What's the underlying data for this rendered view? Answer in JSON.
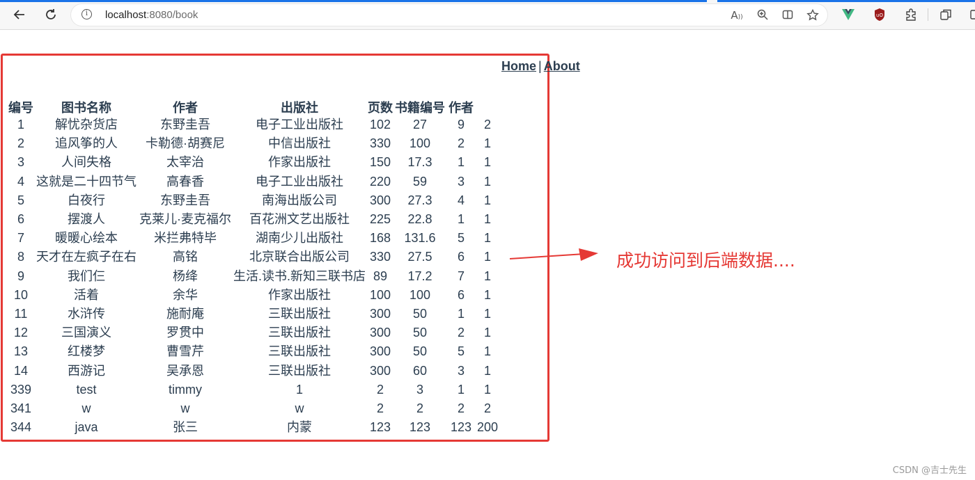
{
  "browser": {
    "url_host": "localhost",
    "url_rest": ":8080/book",
    "accent": "#1a73e8"
  },
  "nav": {
    "home": "Home",
    "separator": "|",
    "about": "About"
  },
  "table": {
    "headers": [
      "编号",
      "图书名称",
      "作者",
      "出版社",
      "页数",
      "书籍编号",
      "作者",
      ""
    ],
    "rows": [
      [
        "1",
        "解忧杂货店",
        "东野圭吾",
        "电子工业出版社",
        "102",
        "27",
        "9",
        "2"
      ],
      [
        "2",
        "追风筝的人",
        "卡勒德·胡赛尼",
        "中信出版社",
        "330",
        "100",
        "2",
        "1"
      ],
      [
        "3",
        "人间失格",
        "太宰治",
        "作家出版社",
        "150",
        "17.3",
        "1",
        "1"
      ],
      [
        "4",
        "这就是二十四节气",
        "高春香",
        "电子工业出版社",
        "220",
        "59",
        "3",
        "1"
      ],
      [
        "5",
        "白夜行",
        "东野圭吾",
        "南海出版公司",
        "300",
        "27.3",
        "4",
        "1"
      ],
      [
        "6",
        "摆渡人",
        "克莱儿·麦克福尔",
        "百花洲文艺出版社",
        "225",
        "22.8",
        "1",
        "1"
      ],
      [
        "7",
        "暖暖心绘本",
        "米拦弗特毕",
        "湖南少儿出版社",
        "168",
        "131.6",
        "5",
        "1"
      ],
      [
        "8",
        "天才在左疯子在右",
        "高铭",
        "北京联合出版公司",
        "330",
        "27.5",
        "6",
        "1"
      ],
      [
        "9",
        "我们仨",
        "杨绛",
        "生活.读书.新知三联书店",
        "89",
        "17.2",
        "7",
        "1"
      ],
      [
        "10",
        "活着",
        "余华",
        "作家出版社",
        "100",
        "100",
        "6",
        "1"
      ],
      [
        "11",
        "水浒传",
        "施耐庵",
        "三联出版社",
        "300",
        "50",
        "1",
        "1"
      ],
      [
        "12",
        "三国演义",
        "罗贯中",
        "三联出版社",
        "300",
        "50",
        "2",
        "1"
      ],
      [
        "13",
        "红楼梦",
        "曹雪芹",
        "三联出版社",
        "300",
        "50",
        "5",
        "1"
      ],
      [
        "14",
        "西游记",
        "吴承恩",
        "三联出版社",
        "300",
        "60",
        "3",
        "1"
      ],
      [
        "339",
        "test",
        "timmy",
        "1",
        "2",
        "3",
        "1",
        "1"
      ],
      [
        "341",
        "w",
        "w",
        "w",
        "2",
        "2",
        "2",
        "2"
      ],
      [
        "344",
        "java",
        "张三",
        "内蒙",
        "123",
        "123",
        "123",
        "200"
      ]
    ]
  },
  "annotation": {
    "text": "成功访问到后端数据....",
    "color": "#e53935"
  },
  "watermark": "CSDN @吉士先生"
}
